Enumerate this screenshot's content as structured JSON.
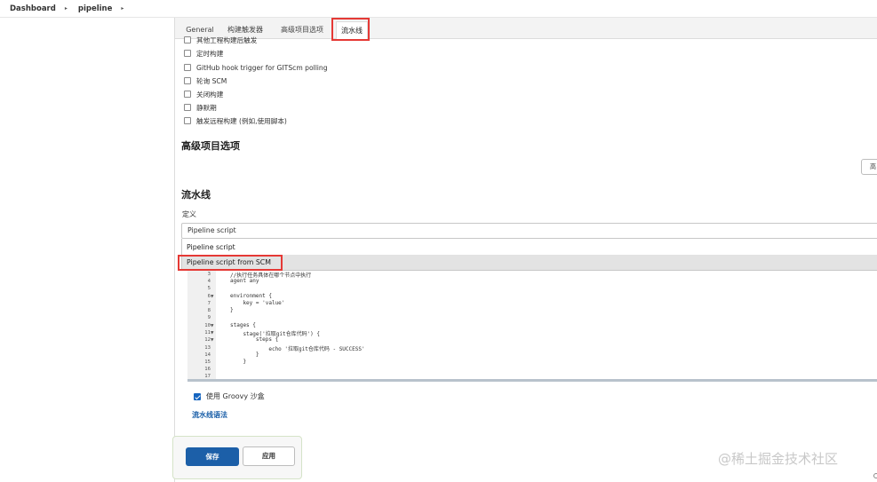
{
  "breadcrumb": {
    "items": [
      "Dashboard",
      "pipeline"
    ]
  },
  "tabs": {
    "general": "General",
    "triggers": "构建触发器",
    "advanced": "高级项目选项",
    "pipeline": "流水线"
  },
  "triggers": {
    "items": [
      {
        "label": "其他工程构建后触发",
        "checked": false
      },
      {
        "label": "定时构建",
        "checked": false
      },
      {
        "label": "GitHub hook trigger for GITScm polling",
        "checked": false
      },
      {
        "label": "轮询 SCM",
        "checked": false
      },
      {
        "label": "关闭构建",
        "checked": false
      },
      {
        "label": "静默期",
        "checked": false
      },
      {
        "label": "触发远程构建 (例如,使用脚本)",
        "checked": false
      }
    ]
  },
  "advanced": {
    "title": "高级项目选项",
    "button_label": "高"
  },
  "pipeline": {
    "title": "流水线",
    "definition_label": "定义",
    "selected": "Pipeline script",
    "options": [
      "Pipeline script",
      "Pipeline script from SCM"
    ],
    "highlighted_option": "Pipeline script from SCM"
  },
  "editor": {
    "line_numbers": [
      "3",
      "4",
      "5",
      "6",
      "7",
      "8",
      "9",
      "10",
      "11",
      "12",
      "13",
      "14",
      "15",
      "16",
      "17"
    ],
    "lines": [
      "//执行任务具体在哪个节点中执行",
      "agent any",
      "",
      "environment {",
      "    key = 'value'",
      "}",
      "",
      "stages {",
      "    stage('拉取git仓库代码') {",
      "        steps {",
      "            echo '拉取git仓库代码 - SUCCESS'",
      "        }",
      "    }",
      "",
      ""
    ]
  },
  "groovy_sandbox": {
    "label": "使用 Groovy 沙盒",
    "checked": true
  },
  "syntax_link": "流水线语法",
  "actions": {
    "save": "保存",
    "apply": "应用"
  },
  "watermark": "@稀土掘金技术社区",
  "colors": {
    "primary": "#1c5fa8",
    "highlight_outline": "#e53935",
    "link": "#1a5fa8"
  }
}
